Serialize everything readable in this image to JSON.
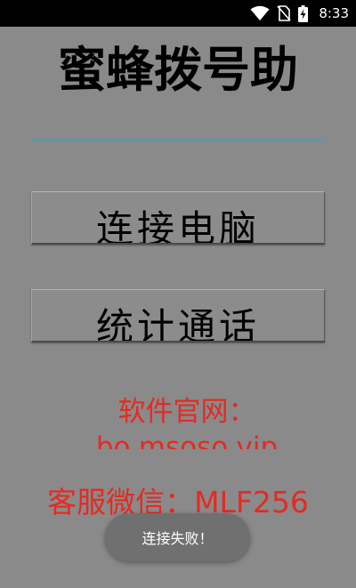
{
  "status_bar": {
    "time": "8:33",
    "icons": [
      "wifi-icon",
      "no-sim-icon",
      "battery-charging-icon"
    ]
  },
  "app": {
    "title": "蜜蜂拨号助"
  },
  "input": {
    "value": "",
    "placeholder": ""
  },
  "buttons": {
    "connect_label": "连接电脑",
    "stats_label": "统计通话"
  },
  "info": {
    "website_label": "软件官网：",
    "website_url": "bo.msoso.vip",
    "service_text": "客服微信：MLF256",
    "text_color": "#e52a22"
  },
  "toast": {
    "message": "连接失败！"
  },
  "colors": {
    "background": "#8a8a8a",
    "input_underline": "#3aa6b8",
    "status_bar": "#000000"
  }
}
